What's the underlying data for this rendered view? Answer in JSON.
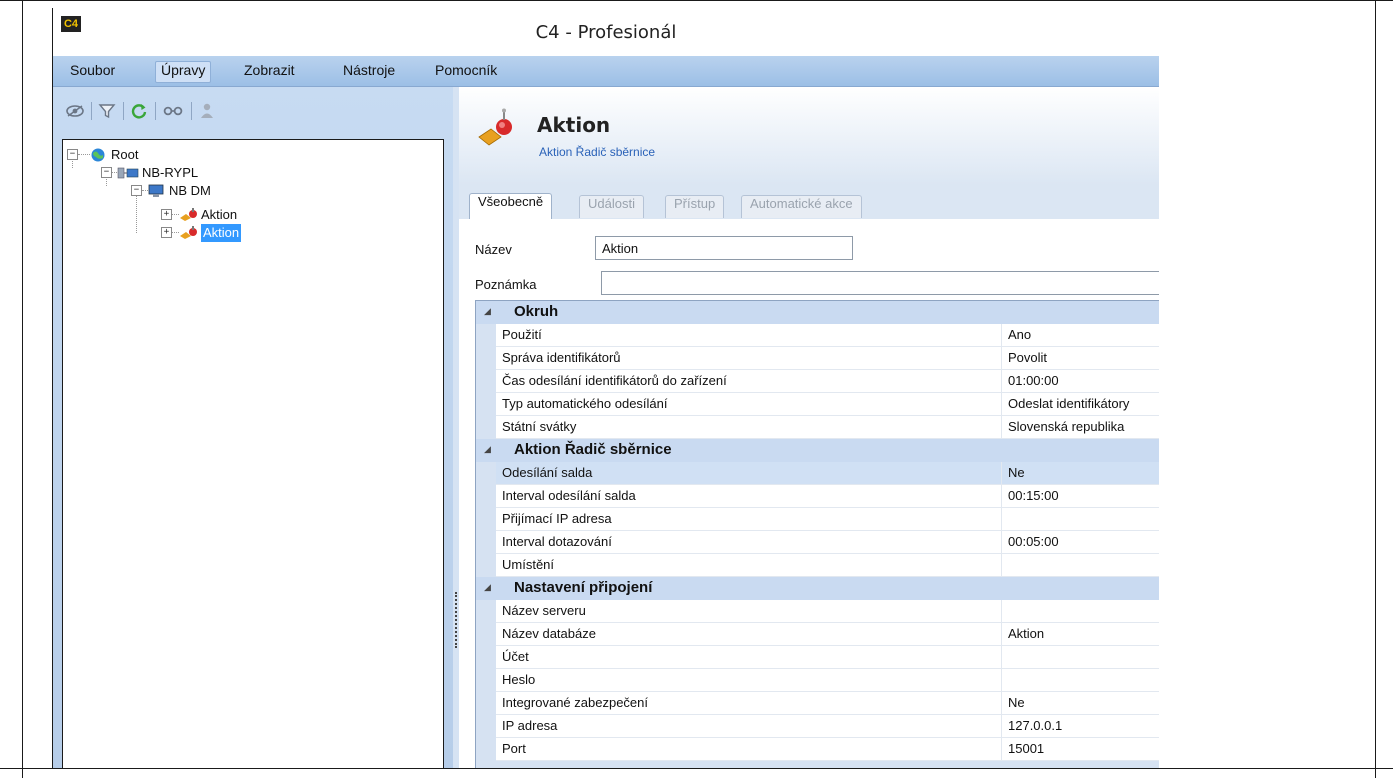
{
  "window": {
    "title": "C4 - Profesionál",
    "app_icon_text": "C4"
  },
  "menu": [
    {
      "label": "Soubor",
      "active": false
    },
    {
      "label": "Úpravy",
      "active": true
    },
    {
      "label": "Zobrazit",
      "active": false
    },
    {
      "label": "Nástroje",
      "active": false
    },
    {
      "label": "Pomocník",
      "active": false
    }
  ],
  "toolbar": {
    "icons": [
      "eye-off-icon",
      "filter-icon",
      "refresh-icon",
      "link-icon",
      "user-icon"
    ]
  },
  "tree": {
    "nodes": [
      {
        "label": "Root",
        "icon": "globe-icon",
        "level": 0,
        "selected": false
      },
      {
        "label": "NB-RYPL",
        "icon": "network-icon",
        "level": 1,
        "selected": false
      },
      {
        "label": "NB DM",
        "icon": "computer-icon",
        "level": 2,
        "selected": false
      },
      {
        "label": "Aktion",
        "icon": "controller-icon",
        "level": 3,
        "selected": false
      },
      {
        "label": "Aktion",
        "icon": "controller-icon",
        "level": 3,
        "selected": true
      }
    ]
  },
  "header": {
    "title": "Aktion",
    "subtitle": "Aktion Řadič sběrnice"
  },
  "tabs": [
    {
      "label": "Všeobecně",
      "active": true
    },
    {
      "label": "Události",
      "active": false
    },
    {
      "label": "Přístup",
      "active": false
    },
    {
      "label": "Automatické akce",
      "active": false
    }
  ],
  "form": {
    "name_label": "Název",
    "name_value": "Aktion",
    "note_label": "Poznámka",
    "note_value": ""
  },
  "grid": {
    "categories": [
      {
        "title": "Okruh",
        "rows": [
          {
            "name": "Použití",
            "value": "Ano"
          },
          {
            "name": "Správa identifikátorů",
            "value": "Povolit"
          },
          {
            "name": "Čas odesílání identifikátorů do zařízení",
            "value": "01:00:00"
          },
          {
            "name": "Typ automatického odesílání",
            "value": "Odeslat identifikátory"
          },
          {
            "name": "Státní svátky",
            "value": "Slovenská republika"
          }
        ]
      },
      {
        "title": "Aktion Řadič sběrnice",
        "rows": [
          {
            "name": "Odesílání salda",
            "value": "Ne",
            "highlight": true
          },
          {
            "name": "Interval odesílání salda",
            "value": "00:15:00"
          },
          {
            "name": "Přijímací IP adresa",
            "value": ""
          },
          {
            "name": "Interval dotazování",
            "value": "00:05:00"
          },
          {
            "name": "Umístění",
            "value": ""
          }
        ]
      },
      {
        "title": "Nastavení připojení",
        "rows": [
          {
            "name": "Název serveru",
            "value": ""
          },
          {
            "name": "Název databáze",
            "value": "Aktion"
          },
          {
            "name": "Účet",
            "value": ""
          },
          {
            "name": "Heslo",
            "value": ""
          },
          {
            "name": "Integrované zabezpečení",
            "value": "Ne"
          },
          {
            "name": "IP adresa",
            "value": "127.0.0.1"
          },
          {
            "name": "Port",
            "value": "15001"
          }
        ]
      }
    ]
  }
}
